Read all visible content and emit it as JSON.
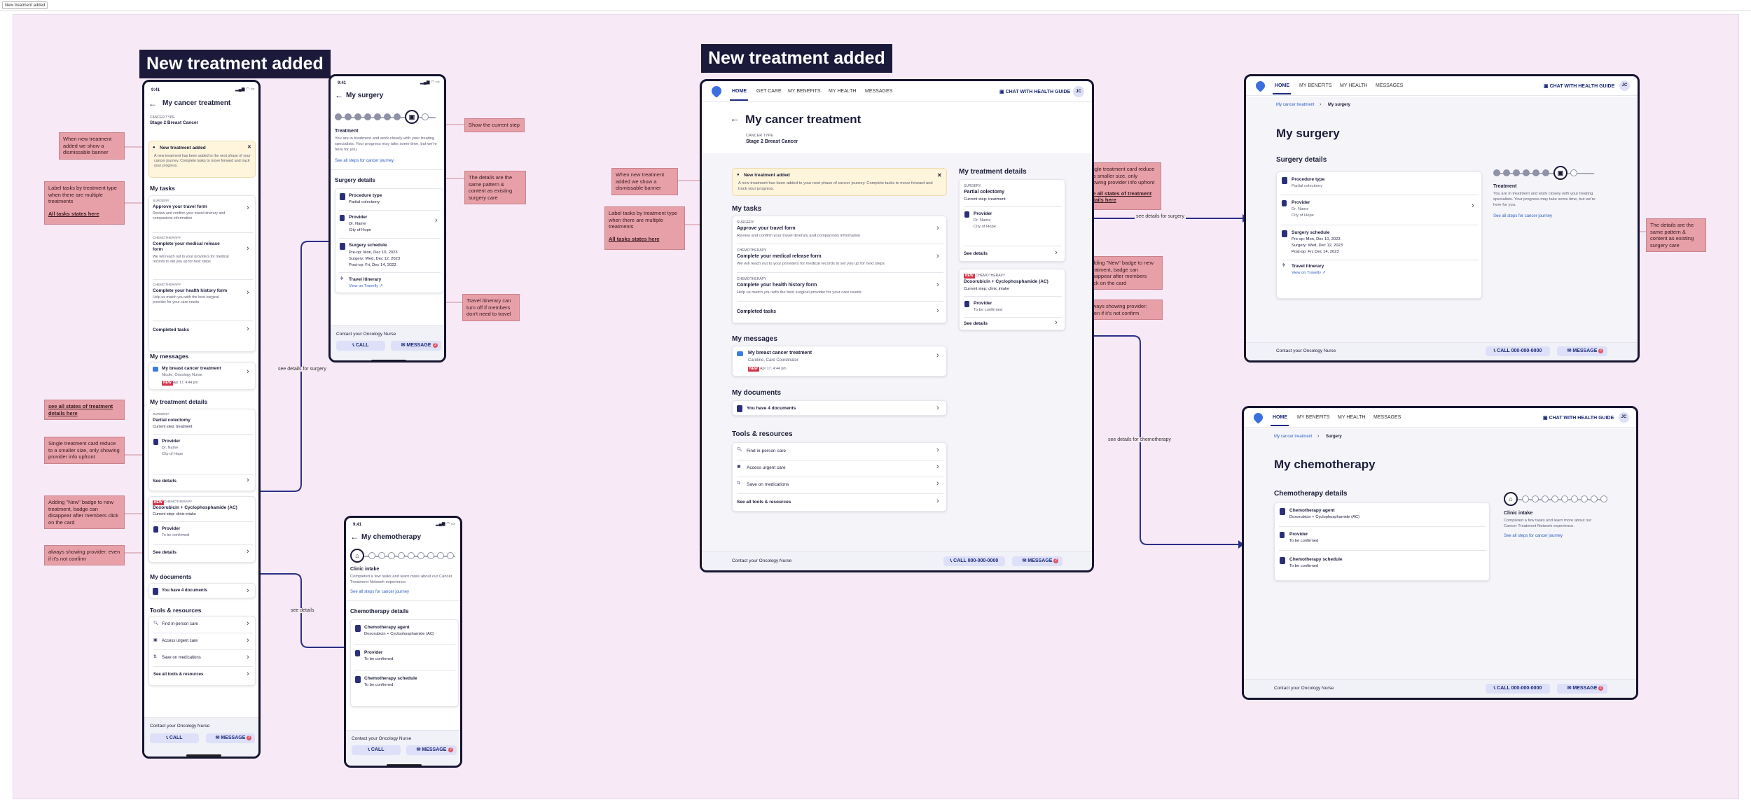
{
  "frame_tab": "New treatment added",
  "title_left": "New treatment added",
  "title_right": "New treatment added",
  "notes": {
    "n1": "When new treatment added we show a dismissable banner",
    "n2": "Label tasks by treatment type when there are multiple treatments",
    "n2_link": "All tasks states here",
    "n3_link": "see all states of treatment details here",
    "n4": "Single treatment card reduce to a smaller size, only showing provider info upfront",
    "n5": "Adding \"New\" badge to new treatment, badge can disappear after members click on the card",
    "n6": "always showing provider: even if it's not confirm",
    "n7": "Show the current step",
    "n8": "The details are the same pattern & content as existing surgery care",
    "n9": "Travel itinerary can turn off if members don't need to travel",
    "d1": "When new treatment added we show a dismissable banner",
    "d2": "Label tasks by treatment type when there are multiple treatments",
    "d2_link": "All tasks states here",
    "d3": "Single treatment card reduce to a smaller size, only showing provider info upfront",
    "d3_link": "see all states of treatment details here",
    "d4": "Adding \"New\" badge to new treatment, badge can disappear after members click on the card",
    "d5": "always showing provider: even if it's not confirm",
    "d6": "The details are the same pattern & content as existing surgery care"
  },
  "connectors": {
    "c1": "see details for surgery",
    "c2": "see details",
    "c3": "see details for surgery",
    "c4": "see details for chemotherapy"
  },
  "common": {
    "time": "9:41",
    "cancer_type_label": "CANCER TYPE",
    "cancer_type": "Stage 2 Breast Cancer",
    "contact": "Contact your Oncology Nurse",
    "call": "CALL",
    "message": "MESSAGE",
    "call_number": "CALL 000-000-0000",
    "badge": "2",
    "new": "NEW",
    "see_details": "See details",
    "see_all_steps": "See all steps for cancer journey"
  },
  "home": {
    "title": "My cancer treatment",
    "banner_title": "New treatment added",
    "banner_text_m": "A new treatment has been added to the next phase of your cancer journey. Complete tasks to move forward and track your progress.",
    "banner_text_d": "A new treatment has been added to your next phase of cancer journey. Complete tasks to move forward and track your progress.",
    "tasks_header": "My tasks",
    "tasks": [
      {
        "type": "SURGERY",
        "title": "Approve your travel form",
        "desc": "Review and confirm your travel itinerary and companions information"
      },
      {
        "type": "CHEMOTHERAPY",
        "title": "Complete your medical release form",
        "desc": "We will reach out to your providers for medical records to set you up for next steps"
      },
      {
        "type": "CHEMOTHERAPY",
        "title": "Complete your health history form",
        "desc": "Help us match you with the best surgical provider for your care needs"
      }
    ],
    "completed_tasks": "Completed tasks",
    "messages_header": "My messages",
    "message_title": "My breast cancer treatment",
    "message_from_m": "Nicole, Oncology Nurse",
    "message_from_d": "Caroline, Care Coordinator",
    "message_time": "Apr 17, 4:44 pm",
    "details_header": "My treatment details",
    "surgery_type": "SURGERY",
    "surgery_name": "Partial colectomy",
    "surgery_step": "Current step: treatment",
    "provider_label": "Provider",
    "provider_lines": [
      "Dr. Name",
      "City of Hope"
    ],
    "chemo_type": "CHEMOTHERAPY",
    "chemo_name": "Doxorubicin + Cyclophosphamide (AC)",
    "chemo_step": "Current step: clinic intake",
    "to_be_confirmed": "To be confirmed",
    "documents_header": "My documents",
    "documents_item": "You have 4 documents",
    "tools_header": "Tools & resources",
    "tools": [
      "Find in-person care",
      "Access urgent care",
      "Save on medications",
      "See all tools & resources"
    ]
  },
  "surgery": {
    "title": "My surgery",
    "step_title": "Treatment",
    "step_text_m": "You are in treatment and work closely with your treating specialists. Your progress may take some time, but we're here for you.",
    "step_text_d": "You are in treatment and work closely with your treating specialists. Your progress may take some time, but we're here for you.",
    "details_header": "Surgery details",
    "procedure_label": "Procedure type",
    "procedure_value": "Partial colectomy",
    "provider_label": "Provider",
    "provider_lines": [
      "Dr. Name",
      "City of Hope"
    ],
    "schedule_label": "Surgery schedule",
    "schedule": [
      "Pre-op: Mon, Dec 10, 2023",
      "Surgery: Wed, Dec 12, 2023",
      "Post-op: Fri, Dec 14, 2023"
    ],
    "travel_label": "Travel itinerary",
    "travel_link": "View on Travelly"
  },
  "chemo": {
    "title": "My chemotherapy",
    "step_title": "Clinic intake",
    "step_text": "Completed a few tasks and learn more about our Cancer Treatment Network experience.",
    "details_header": "Chemotherapy details",
    "agent_label": "Chemotherapy agent",
    "agent_value": "Doxorubicin + Cyclophosphamide (AC)",
    "provider_label": "Provider",
    "provider_value": "To be confirmed",
    "schedule_label": "Chemotherapy schedule",
    "schedule_value": "To be confirmed"
  },
  "nav": {
    "home": "HOME",
    "get_care": "GET CARE",
    "benefits": "MY BENEFITS",
    "health": "MY HEALTH",
    "messages": "MESSAGES",
    "chat": "CHAT WITH HEALTH GUIDE",
    "avatar": "JC",
    "breadcrumb_root": "My cancer treatment",
    "breadcrumb_surgery": "My surgery",
    "breadcrumb_chemo": "Surgery"
  },
  "colors": {
    "accent": "#1c1a3a",
    "note": "#e7a0a8",
    "canvas": "#f7eaf6",
    "link": "#2f5fc8",
    "connector": "#2b2f86",
    "new_badge": "#d3344a"
  }
}
